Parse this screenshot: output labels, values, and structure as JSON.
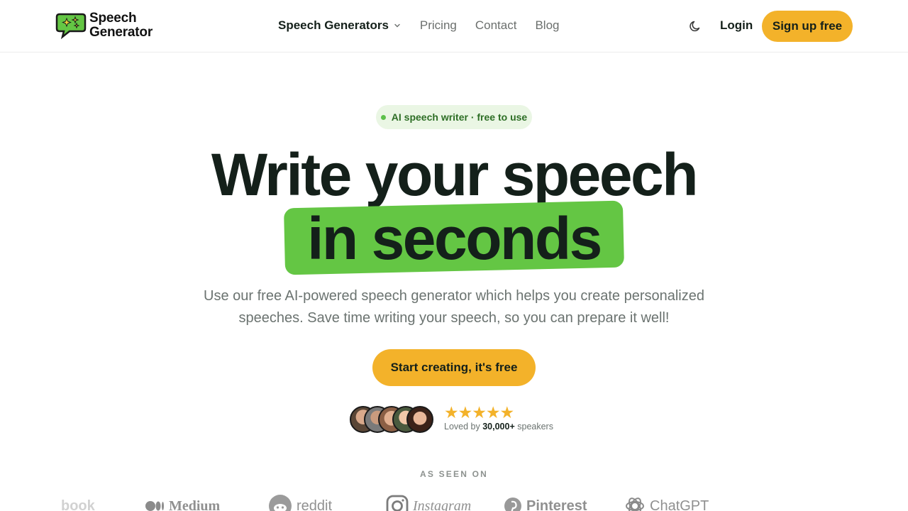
{
  "header": {
    "logo": {
      "line1": "Speech",
      "line2": "Generator"
    },
    "nav": [
      {
        "label": "Speech Generators",
        "dropdown": true
      },
      {
        "label": "Pricing"
      },
      {
        "label": "Contact"
      },
      {
        "label": "Blog"
      }
    ],
    "theme_icon": "moon-icon",
    "login_label": "Login",
    "signup_label": "Sign up free"
  },
  "hero": {
    "badge": "AI speech writer · free to use",
    "headline_line1": "Write your speech",
    "headline_line2": "in seconds",
    "subtitle": "Use our free AI-powered speech generator which helps you create personalized speeches. Save time writing your speech, so you can prepare it well!",
    "cta_label": "Start creating, it's free",
    "rating": {
      "stars": "★★★★★",
      "prefix": "Loved by",
      "count": "30,000+",
      "suffix": "speakers"
    }
  },
  "as_seen_on": {
    "heading": "AS SEEN ON",
    "brands": [
      "book",
      "Medium",
      "reddit",
      "Instagram",
      "Pinterest",
      "ChatGPT"
    ]
  },
  "colors": {
    "accent_yellow": "#f3b22a",
    "highlight_green": "#64c644",
    "badge_bg": "#eaf6e4",
    "text_dark": "#14201a"
  }
}
